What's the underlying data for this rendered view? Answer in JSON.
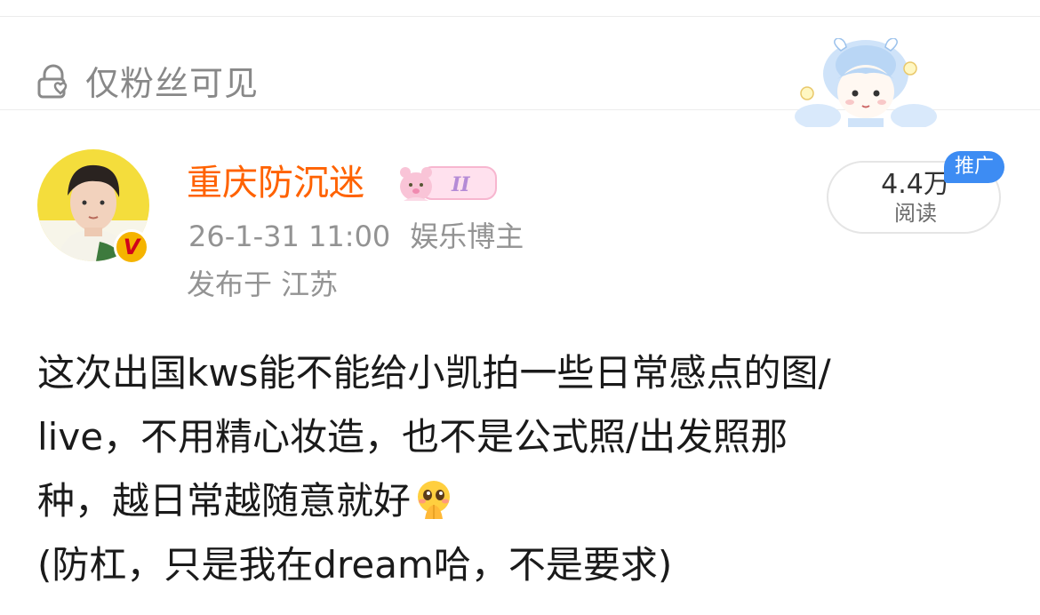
{
  "visibility": {
    "label": "仅粉丝可见"
  },
  "author": {
    "name": "重庆防沉迷",
    "timestamp": "26-1-31 11:00",
    "category": "娱乐博主",
    "location": "发布于 江苏",
    "verified": true,
    "name_color": "#ff6200"
  },
  "stats": {
    "reads_count": "4.4万",
    "reads_label": "阅读",
    "promo_label": "推广"
  },
  "post": {
    "lines": [
      "这次出国kws能不能给小凯拍一些日常感点的图/",
      "live，不用精心妆造，也不是公式照/出发照那",
      "种，越日常越随意就好",
      "(防杠，只是我在dream哈，不是要求)"
    ],
    "emoji": "pleading-hands-emoji"
  },
  "colors": {
    "accent": "#ff6200",
    "promo": "#3d8cf3",
    "meta": "#939393"
  }
}
